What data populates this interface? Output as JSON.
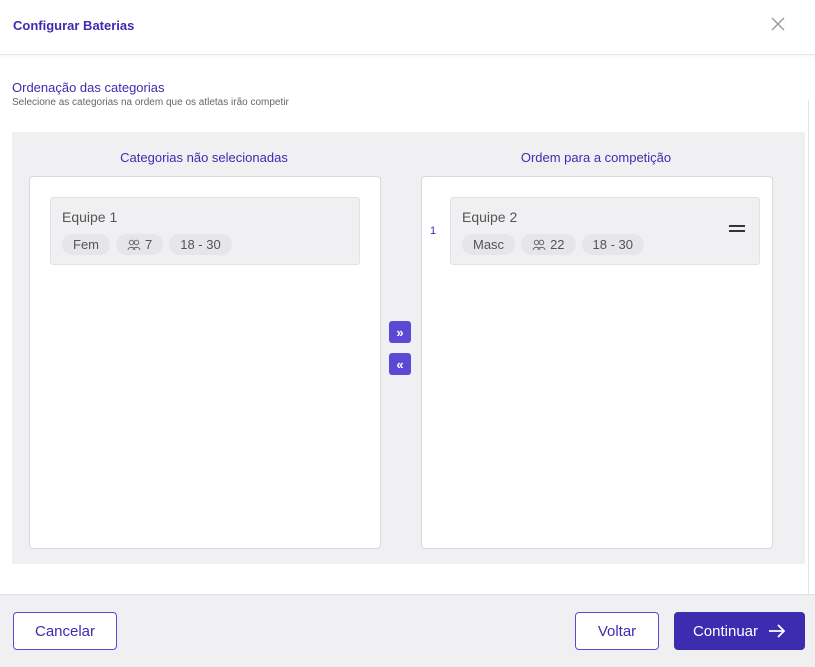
{
  "header": {
    "title": "Configurar Baterias",
    "close_icon": "close-icon"
  },
  "section": {
    "title": "Ordenação das categorias",
    "subtitle": "Selecione as categorias na ordem que os atletas irão competir"
  },
  "left_column": {
    "title": "Categorias não selecionadas",
    "items": [
      {
        "name": "Equipe 1",
        "gender": "Fem",
        "athletes": "7",
        "age_range": "18 - 30"
      }
    ]
  },
  "right_column": {
    "title": "Ordem para a competição",
    "items": [
      {
        "order": "1",
        "name": "Equipe 2",
        "gender": "Masc",
        "athletes": "22",
        "age_range": "18 - 30"
      }
    ]
  },
  "transfer": {
    "add_label": "»",
    "remove_label": "«"
  },
  "footer": {
    "cancel_label": "Cancelar",
    "back_label": "Voltar",
    "continue_label": "Continuar"
  },
  "colors": {
    "accent": "#3d2bb0",
    "button": "#5b49d6",
    "panel": "#f0f0f2"
  }
}
